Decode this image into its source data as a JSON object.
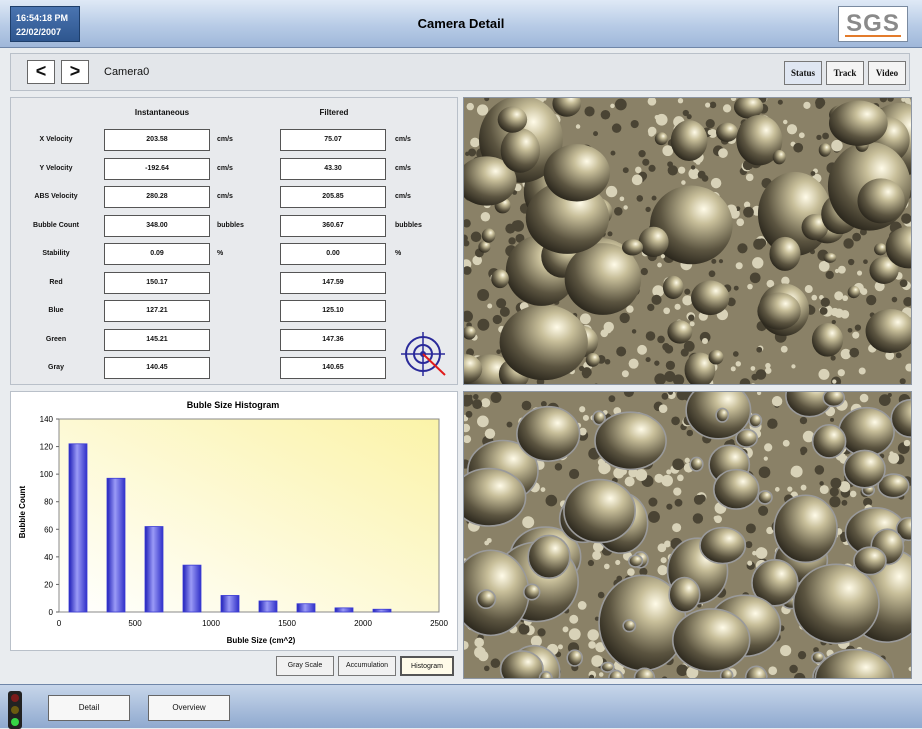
{
  "header": {
    "time": "16:54:18 PM",
    "date": "22/02/2007",
    "title": "Camera Detail",
    "logo": "SGS"
  },
  "nav": {
    "prev": "<",
    "next": ">",
    "camera": "Camera0",
    "buttons": [
      "Status",
      "Track",
      "Video"
    ]
  },
  "data_panel": {
    "col_instantaneous": "Instantaneous",
    "col_filtered": "Filtered",
    "rows": [
      {
        "label": "X Velocity",
        "inst": "203.58",
        "inst_unit": "cm/s",
        "filt": "75.07",
        "filt_unit": "cm/s"
      },
      {
        "label": "Y Velocity",
        "inst": "-192.64",
        "inst_unit": "cm/s",
        "filt": "43.30",
        "filt_unit": "cm/s"
      },
      {
        "label": "ABS Velocity",
        "inst": "280.28",
        "inst_unit": "cm/s",
        "filt": "205.85",
        "filt_unit": "cm/s"
      },
      {
        "label": "Bubble Count",
        "inst": "348.00",
        "inst_unit": "bubbles",
        "filt": "360.67",
        "filt_unit": "bubbles"
      },
      {
        "label": "Stability",
        "inst": "0.09",
        "inst_unit": "%",
        "filt": "0.00",
        "filt_unit": "%"
      },
      {
        "label": "Red",
        "inst": "150.17",
        "inst_unit": "",
        "filt": "147.59",
        "filt_unit": ""
      },
      {
        "label": "Blue",
        "inst": "127.21",
        "inst_unit": "",
        "filt": "125.10",
        "filt_unit": ""
      },
      {
        "label": "Green",
        "inst": "145.21",
        "inst_unit": "",
        "filt": "147.36",
        "filt_unit": ""
      },
      {
        "label": "Gray",
        "inst": "140.45",
        "inst_unit": "",
        "filt": "140.65",
        "filt_unit": ""
      }
    ]
  },
  "chart_data": {
    "type": "bar",
    "title": "Buble Size Histogram",
    "xlabel": "Buble Size (cm^2)",
    "ylabel": "Bubble Count",
    "x": [
      125,
      375,
      625,
      875,
      1125,
      1375,
      1625,
      1875,
      2125
    ],
    "values": [
      122,
      97,
      62,
      34,
      12,
      8,
      6,
      3,
      2
    ],
    "xlim": [
      0,
      2500
    ],
    "ylim": [
      0,
      140
    ],
    "xticks": [
      0,
      500,
      1000,
      1500,
      2000,
      2500
    ],
    "yticks": [
      0,
      20,
      40,
      60,
      80,
      100,
      120,
      140
    ],
    "grid": false,
    "bar_color": "#3b3bd6"
  },
  "hist_buttons": {
    "gray_scale": "Gray Scale",
    "accumulation": "Accumulation",
    "histogram": "Histogram"
  },
  "footer": {
    "detail": "Detail",
    "overview": "Overview"
  },
  "colors": {
    "accent": "#2e568f",
    "light_red": "#7a1b1b",
    "light_yellow": "#6a5a10",
    "light_green": "#36d646"
  }
}
